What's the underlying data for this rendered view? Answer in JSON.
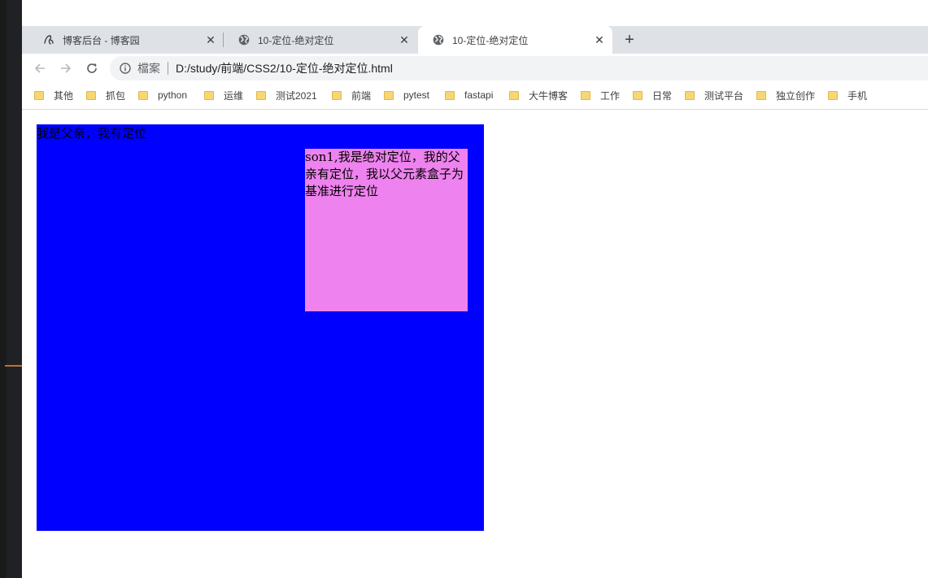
{
  "tabs": [
    {
      "title": "博客后台 - 博客园",
      "icon": "cnblogs-icon",
      "active": false
    },
    {
      "title": "10-定位-绝对定位",
      "icon": "globe-icon",
      "active": false
    },
    {
      "title": "10-定位-绝对定位",
      "icon": "globe-icon",
      "active": true
    }
  ],
  "tab_close_glyph": "✕",
  "new_tab_glyph": "+",
  "address_bar": {
    "scheme_label": "檔案",
    "url": "D:/study/前端/CSS2/10-定位-绝对定位.html"
  },
  "bookmarks": [
    "其他",
    "抓包",
    "python",
    "运维",
    "测试2021",
    "前端",
    "pytest",
    "fastapi",
    "大牛博客",
    "工作",
    "日常",
    "测试平台",
    "独立创作",
    "手机"
  ],
  "page": {
    "father_text": "我是父亲，我有定位",
    "son_text": "son1,我是绝对定位，我的父亲有定位，我以父元素盒子为基准进行定位",
    "father_color": "#0000ff",
    "son_color": "#ee82ee"
  }
}
